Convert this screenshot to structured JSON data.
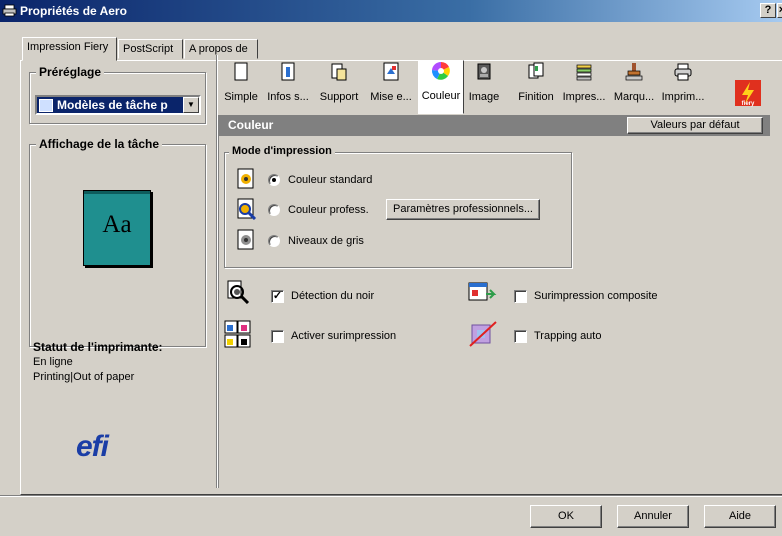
{
  "window": {
    "title": "Propriétés de Aero",
    "help_label": "?",
    "close_label": "×"
  },
  "tabs": [
    {
      "label": "Impression Fiery",
      "active": true
    },
    {
      "label": "PostScript"
    },
    {
      "label": "A propos de"
    }
  ],
  "sidebar": {
    "preset_title": "Préréglage",
    "preset_value": "Modèles de tâche p",
    "preview_title": "Affichage de la tâche",
    "preview_text": "Aa",
    "status_title": "Statut de l'imprimante:",
    "status_lines": [
      "En ligne",
      "Printing|Out of paper"
    ],
    "logo_text": "efi"
  },
  "toolbar": {
    "items": [
      {
        "label": "Simple",
        "icon": "blank-page-icon"
      },
      {
        "label": "Infos s...",
        "icon": "info-page-icon"
      },
      {
        "label": "Support",
        "icon": "media-icon"
      },
      {
        "label": "Mise e...",
        "icon": "layout-icon"
      },
      {
        "label": "Couleur",
        "icon": "color-wheel-icon",
        "active": true
      },
      {
        "label": "Image",
        "icon": "image-icon"
      },
      {
        "label": "Finition",
        "icon": "finishing-icon"
      },
      {
        "label": "Impres...",
        "icon": "stack-icon"
      },
      {
        "label": "Marqu...",
        "icon": "stamp-icon"
      },
      {
        "label": "Imprim...",
        "icon": "printer-icon"
      }
    ],
    "brand_logo": "fiery"
  },
  "section": {
    "title": "Couleur",
    "defaults_button": "Valeurs par défaut"
  },
  "print_mode": {
    "title": "Mode d'impression",
    "options": [
      {
        "label": "Couleur standard",
        "selected": true
      },
      {
        "label": "Couleur profess.",
        "selected": false
      },
      {
        "label": "Niveaux de gris",
        "selected": false
      }
    ],
    "pro_settings_button": "Paramètres professionnels..."
  },
  "options": {
    "black_detection": {
      "label": "Détection du noir",
      "checked": true
    },
    "enable_overprint": {
      "label": "Activer surimpression",
      "checked": false
    },
    "composite_overprint": {
      "label": "Surimpression composite",
      "checked": false
    },
    "auto_trapping": {
      "label": "Trapping auto",
      "checked": false
    }
  },
  "footer": {
    "ok": "OK",
    "cancel": "Annuler",
    "help": "Aide"
  },
  "colors": {
    "title_bar": "#0a246a",
    "face": "#d4d0c8",
    "section_bar": "#808080",
    "preview": "#1f8f8f",
    "efi": "#1a3da6",
    "fiery": "#e0301e"
  }
}
